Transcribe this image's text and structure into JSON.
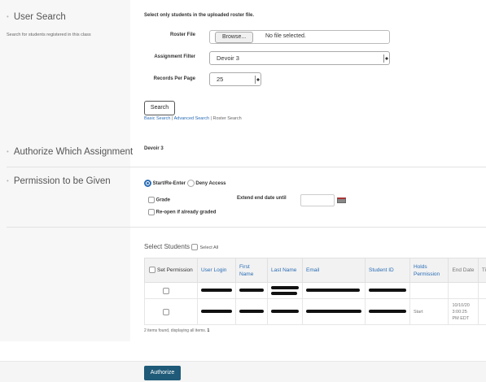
{
  "sections": {
    "user_search": {
      "title": "User Search",
      "subtitle": "Search for students registered in this class"
    },
    "authorize_assignment": {
      "title": "Authorize Which Assignment",
      "value": "Devoir 3"
    },
    "permission": {
      "title": "Permission to be Given"
    }
  },
  "search_form": {
    "roster_only_label": "Select only students in the uploaded roster file.",
    "roster_file_label": "Roster File",
    "browse_label": "Browse...",
    "no_file_label": "No file selected.",
    "assignment_filter_label": "Assignment Filter",
    "assignment_filter_value": "Devoir 3",
    "records_per_page_label": "Records Per Page",
    "records_per_page_value": "25",
    "search_button": "Search",
    "links": {
      "basic": "Basic Search",
      "sep1": " | ",
      "advanced": "Advanced Search",
      "sep2": " | ",
      "roster": "Roster Search"
    }
  },
  "permission_options": {
    "start_reenter": "Start/Re-Enter",
    "deny_access": "Deny Access",
    "extend_label": "Extend end date until",
    "grade_label": "Grade",
    "reopen_label": "Re-open if already graded"
  },
  "students": {
    "title": "Select Students",
    "select_all": "Select All",
    "columns": {
      "set_permission": "Set Permission",
      "user_login": "User Login",
      "first_name": "First Name",
      "last_name": "Last Name",
      "email": "Email",
      "student_id": "Student ID",
      "holds_permission": "Holds Permission",
      "end_date": "End Date",
      "time_limit": "Ti Lin"
    },
    "rows": [
      {
        "holds_permission": "",
        "end_date": ""
      },
      {
        "holds_permission": "Start",
        "end_date": "10/10/20 3:00:25 PM EDT"
      }
    ],
    "footer_prefix": "2 items found, displaying all items.",
    "footer_page": "1"
  },
  "authorize_button": "Authorize",
  "colors": {
    "link": "#2a6db5",
    "authorize_bg": "#1f5a78",
    "left_panel_bg": "#f7f7f7"
  }
}
